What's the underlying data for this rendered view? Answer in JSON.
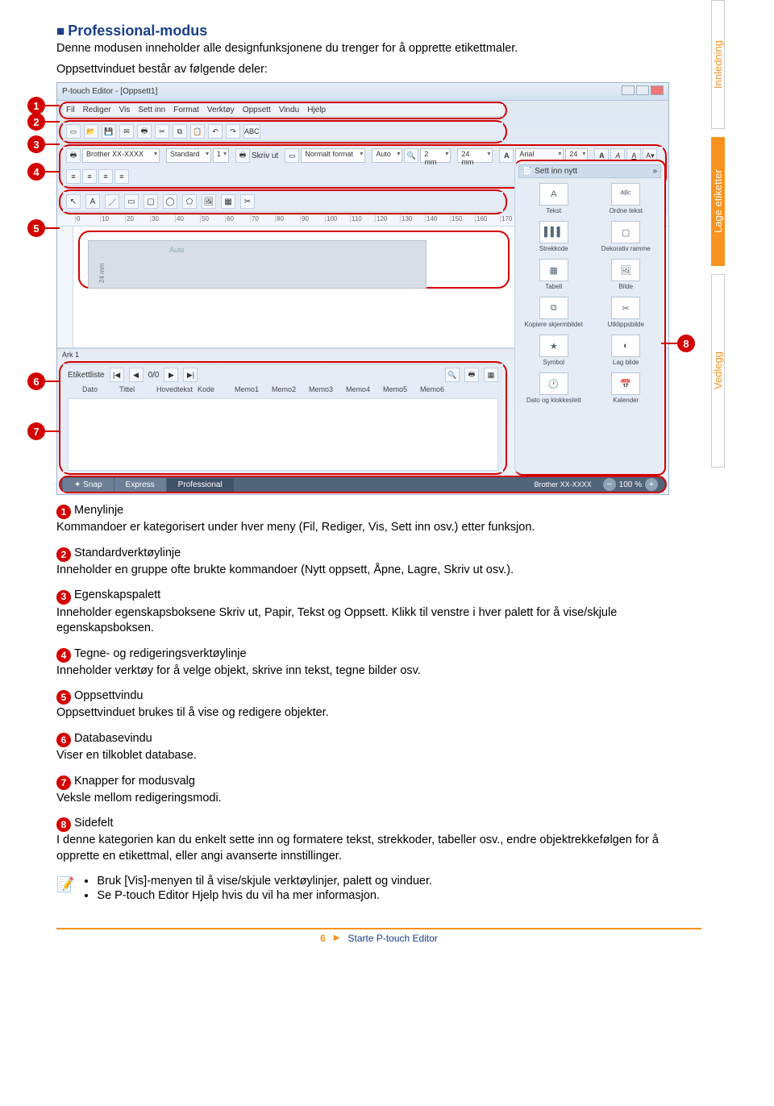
{
  "section": {
    "title": "Professional-modus",
    "intro_1": "Denne modusen inneholder alle designfunksjonene du trenger for å opprette etikettmaler.",
    "intro_2": "Oppsettvinduet består av følgende deler:"
  },
  "side_tabs": {
    "t1": "Innledning",
    "t2": "Lage etiketter",
    "t3": "Vedlegg"
  },
  "screenshot": {
    "title": "P-touch Editor - [Oppsett1]",
    "menu": {
      "m1": "Fil",
      "m2": "Rediger",
      "m3": "Vis",
      "m4": "Sett inn",
      "m5": "Format",
      "m6": "Verktøy",
      "m7": "Oppsett",
      "m8": "Vindu",
      "m9": "Hjelp"
    },
    "toolbar": {
      "abc": "ABC"
    },
    "palette": {
      "printer": "Brother XX-XXXX",
      "standard": "Standard",
      "one": "1",
      "skrivut": "Skriv ut",
      "normalft": "Normalt format",
      "auto": "Auto",
      "mm24": "24 mm",
      "mm2": "2 mm",
      "arial": "Arial",
      "fs": "24"
    },
    "ruler": {
      "r0": "0",
      "r1": "10",
      "r2": "20",
      "r3": "30",
      "r4": "40",
      "r5": "50",
      "r6": "60",
      "r7": "70",
      "r8": "80",
      "r9": "90",
      "r10": "100",
      "r11": "110",
      "r12": "120",
      "r13": "130",
      "r14": "140",
      "r15": "150",
      "r16": "160",
      "r17": "170"
    },
    "canvas": {
      "vlabel": "24 mm",
      "autotxt": "Auto"
    },
    "ark": "Ark 1",
    "db": {
      "hdr": "Etikettliste",
      "nav": "0/0",
      "c1": "Dato",
      "c2": "Tittel",
      "c3": "Hovedtekst",
      "c4": "Kode",
      "c5": "Memo1",
      "c6": "Memo2",
      "c7": "Memo3",
      "c8": "Memo4",
      "c9": "Memo5",
      "c10": "Memo6"
    },
    "modebar": {
      "snap": "Snap",
      "express": "Express",
      "pro": "Professional",
      "printer": "Brother XX-XXXX",
      "zoom": "100 %"
    },
    "sidepanel": {
      "head": "Sett inn nytt",
      "i1": "Tekst",
      "i2": "Ordne tekst",
      "i3": "Strekkode",
      "i4": "Dekorativ ramme",
      "i5": "Tabell",
      "i6": "Bilde",
      "i7": "Kopiere skjermbildet",
      "i8": "Utklippsbilde",
      "i9": "Symbol",
      "i10": "Lag bilde",
      "i11": "Dato og klokkeslett",
      "i12": "Kalender"
    }
  },
  "callouts": {
    "c1": "1",
    "c2": "2",
    "c3": "3",
    "c4": "4",
    "c5": "5",
    "c6": "6",
    "c7": "7",
    "c8": "8"
  },
  "descriptions": {
    "d1": {
      "label": "Menylinje",
      "body": "Kommandoer er kategorisert under hver meny (Fil, Rediger, Vis, Sett inn osv.) etter funksjon."
    },
    "d2": {
      "label": "Standardverktøylinje",
      "body": "Inneholder en gruppe ofte brukte kommandoer (Nytt oppsett, Åpne, Lagre, Skriv ut osv.)."
    },
    "d3": {
      "label": "Egenskapspalett",
      "body": "Inneholder egenskapsboksene Skriv ut, Papir, Tekst og Oppsett. Klikk til venstre i hver palett for å vise/skjule egenskapsboksen."
    },
    "d4": {
      "label": "Tegne- og redigeringsverktøylinje",
      "body": "Inneholder verktøy for å velge objekt, skrive inn tekst, tegne bilder osv."
    },
    "d5": {
      "label": "Oppsettvindu",
      "body": "Oppsettvinduet brukes til å vise og redigere objekter."
    },
    "d6": {
      "label": "Databasevindu",
      "body": "Viser en tilkoblet database."
    },
    "d7": {
      "label": "Knapper for modusvalg",
      "body": "Veksle mellom redigeringsmodi."
    },
    "d8": {
      "label": "Sidefelt",
      "body": "I denne kategorien kan du enkelt sette inn og formatere tekst, strekkoder, tabeller osv., endre objektrekkefølgen for å opprette en etikettmal, eller angi avanserte innstillinger."
    }
  },
  "notes": {
    "n1": "Bruk [Vis]-menyen til å vise/skjule verktøylinjer, palett og vinduer.",
    "n2": "Se P-touch Editor Hjelp hvis du vil ha mer informasjon."
  },
  "footer": {
    "page": "6",
    "crumb": "Starte P-touch Editor"
  }
}
